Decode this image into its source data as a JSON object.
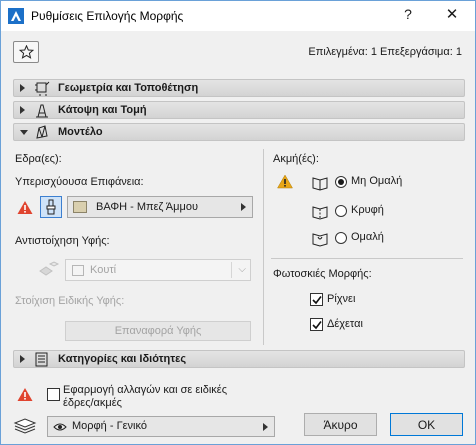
{
  "window": {
    "title": "Ρυθμίσεις Επιλογής Μορφής",
    "help": "?",
    "close": "✕"
  },
  "header": {
    "selected_info": "Επιλεγμένα: 1 Επεξεργάσιμα: 1"
  },
  "panels": {
    "geometry": "Γεωμετρία και Τοποθέτηση",
    "plan": "Κάτοψη και Τομή",
    "model": "Μοντέλο",
    "categories": "Κατηγορίες και Ιδιότητες"
  },
  "model": {
    "faces_label": "Εδρα(ες):",
    "override_label": "Υπερισχύουσα Επιφάνεια:",
    "surface_value": "ΒΑΦΗ - Μπεζ Άμμου",
    "texture_map_label": "Αντιστοίχηση Υφής:",
    "texture_value": "Κουτί",
    "align_label": "Στοίχιση Ειδικής Υφής:",
    "reset_button": "Επαναφορά Υφής",
    "edges_label": "Ακμή(ές):",
    "edge_options": [
      "Μη Ομαλή",
      "Κρυφή",
      "Ομαλή"
    ],
    "edge_selected": "Μη Ομαλή",
    "shadows_label": "Φωτοσκιές Μορφής:",
    "casts_label": "Ρίχνει",
    "receives_label": "Δέχεται",
    "casts_checked": true,
    "receives_checked": true
  },
  "footer": {
    "apply_label": "Εφαρμογή αλλαγών και σε ειδικές",
    "apply_label_2": "έδρες/ακμές",
    "apply_checked": false,
    "layer_value": "Μορφή - Γενικό",
    "cancel": "Άκυρο",
    "ok": "OK"
  },
  "colors": {
    "accent": "#0078d7",
    "warning": "#e8a617",
    "error": "#e0442f",
    "swatch": "#d9cfae"
  }
}
